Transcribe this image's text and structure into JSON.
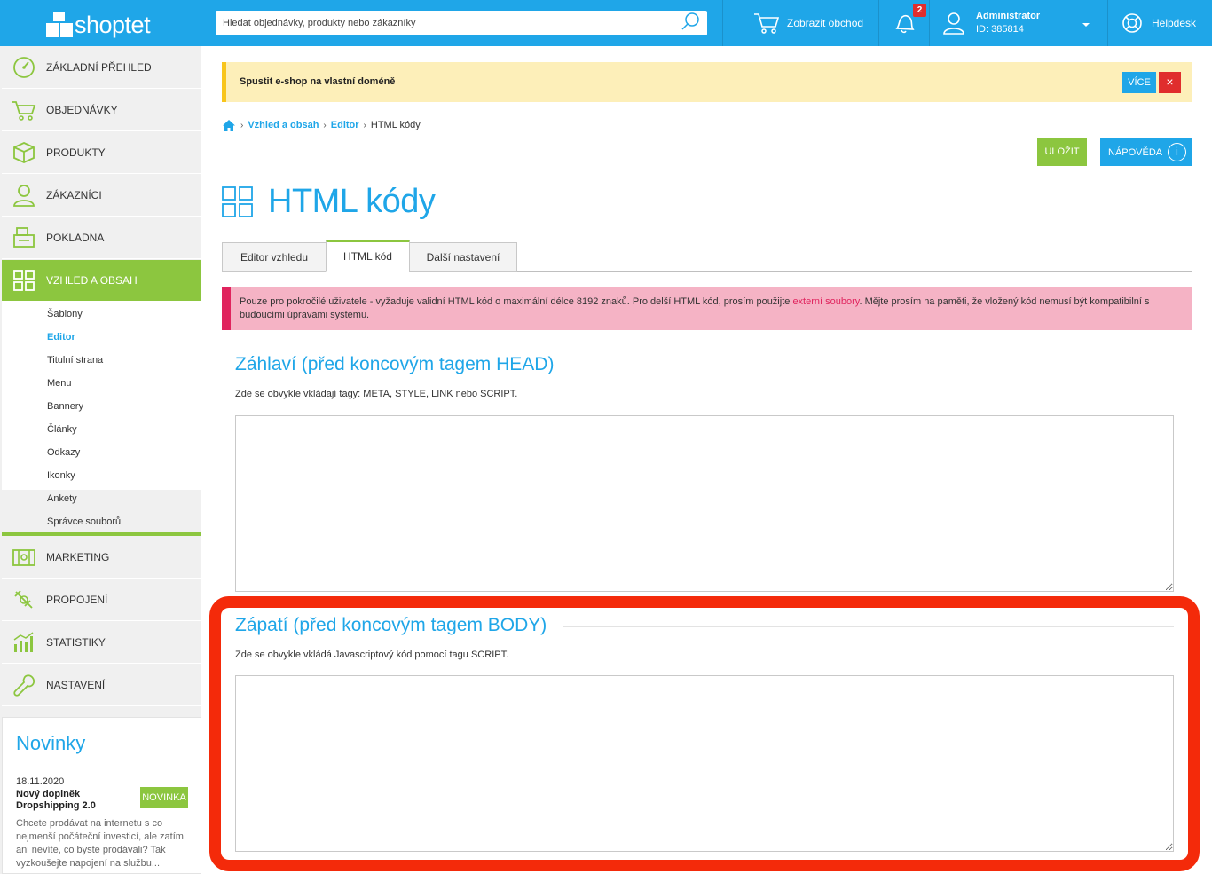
{
  "header": {
    "logo_text": "shoptet",
    "search_placeholder": "Hledat objednávky, produkty nebo zákazníky",
    "show_shop": "Zobrazit obchod",
    "notifications_count": "2",
    "admin_name": "Administrator",
    "admin_id": "ID: 385814",
    "helpdesk": "Helpdesk"
  },
  "sidebar": {
    "items": [
      {
        "label": "ZÁKLADNÍ PŘEHLED",
        "icon": "dashboard-icon"
      },
      {
        "label": "OBJEDNÁVKY",
        "icon": "cart-icon"
      },
      {
        "label": "PRODUKTY",
        "icon": "box-icon"
      },
      {
        "label": "ZÁKAZNÍCI",
        "icon": "user-icon"
      },
      {
        "label": "POKLADNA",
        "icon": "register-icon"
      },
      {
        "label": "VZHLED A OBSAH",
        "icon": "layout-icon"
      },
      {
        "label": "MARKETING",
        "icon": "marketing-icon"
      },
      {
        "label": "PROPOJENÍ",
        "icon": "plug-icon"
      },
      {
        "label": "STATISTIKY",
        "icon": "stats-icon"
      },
      {
        "label": "NASTAVENÍ",
        "icon": "wrench-icon"
      }
    ],
    "subitems": [
      "Šablony",
      "Editor",
      "Titulní strana",
      "Menu",
      "Bannery",
      "Články",
      "Odkazy",
      "Ikonky",
      "Ankety",
      "Správce souborů"
    ]
  },
  "news": {
    "title": "Novinky",
    "date": "18.11.2020",
    "headline": "Nový doplněk Dropshipping 2.0",
    "badge": "NOVINKA",
    "text": "Chcete prodávat na internetu s co nejmenší počáteční investicí, ale zatím ani nevíte, co byste prodávali? Tak vyzkoušejte napojení na službu..."
  },
  "alert": {
    "text": "Spustit e-shop na vlastní doméně",
    "more": "VÍCE",
    "close": "×"
  },
  "breadcrumb": {
    "level1": "Vzhled a obsah",
    "level2": "Editor",
    "current": "HTML kódy"
  },
  "actions": {
    "save": "ULOŽIT",
    "help": "NÁPOVĚDA",
    "help_icon": "i"
  },
  "page": {
    "title": "HTML kódy"
  },
  "tabs": [
    "Editor vzhledu",
    "HTML kód",
    "Další nastavení"
  ],
  "warning": {
    "text_before": "Pouze pro pokročilé uživatele - vyžaduje validní HTML kód o maximální délce 8192 znaků. Pro delší HTML kód, prosím použijte ",
    "link": "externí soubory",
    "text_after": ". Mějte prosím na paměti, že vložený kód nemusí být kompatibilní s budoucími úpravami systému."
  },
  "head_section": {
    "title": "Záhlaví (před koncovým tagem HEAD)",
    "desc": "Zde se obvykle vkládají tagy: META, STYLE, LINK nebo SCRIPT.",
    "value": ""
  },
  "body_section": {
    "title": "Zápatí (před koncovým tagem BODY)",
    "desc": "Zde se obvykle vkládá Javascriptový kód pomocí tagu SCRIPT.",
    "value": ""
  },
  "colors": {
    "brand_blue": "#1fa6e8",
    "brand_green": "#8cc63f",
    "alert_yellow": "#fdefb9",
    "warning_pink": "#f5b3c5",
    "highlight_red": "#f42a0a"
  }
}
